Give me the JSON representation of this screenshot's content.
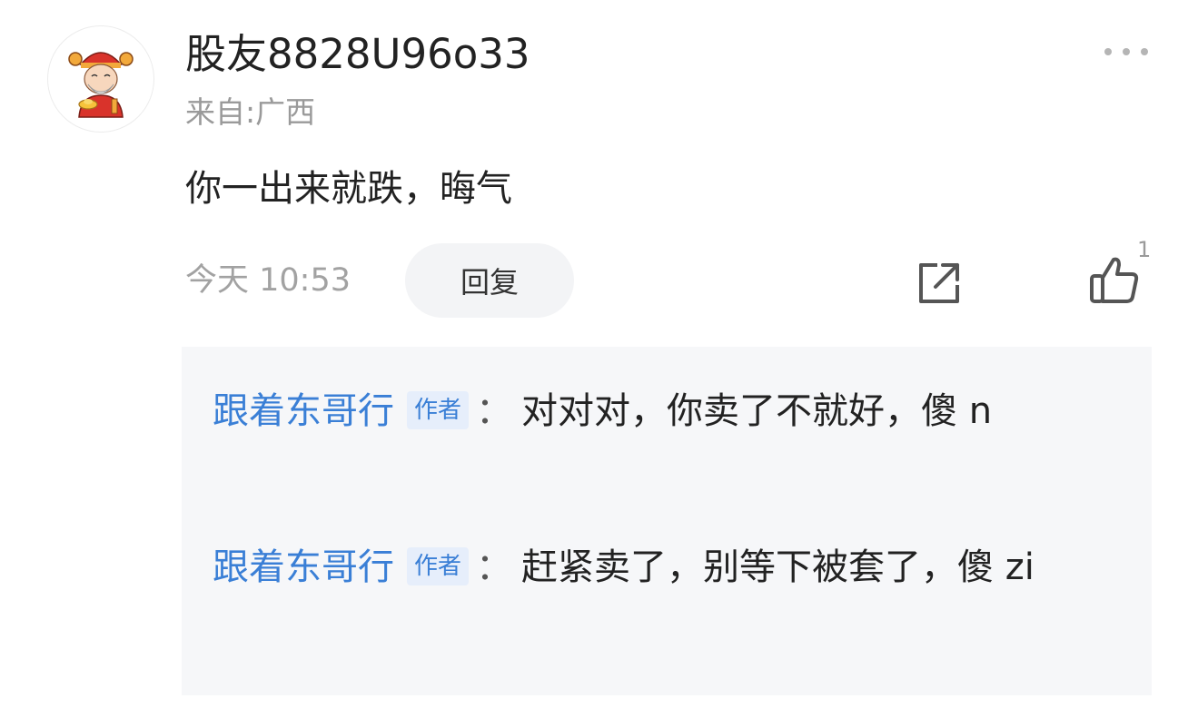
{
  "comment": {
    "username": "股友8828U96o33",
    "location": "来自:广西",
    "text": "你一出来就跌，晦气",
    "timestamp": "今天 10:53",
    "reply_label": "回复",
    "like_count": "1"
  },
  "replies": [
    {
      "author": "跟着东哥行",
      "badge": "作者",
      "separator": "：",
      "text": "对对对，你卖了不就好，傻 n"
    },
    {
      "author": "跟着东哥行",
      "badge": "作者",
      "separator": "：",
      "text": "赶紧卖了，别等下被套了，傻 zi"
    }
  ],
  "icons": {
    "avatar": "caishen-avatar",
    "more": "more-dots-icon",
    "share": "share-icon",
    "like": "thumbs-up-icon"
  },
  "colors": {
    "author_link": "#3a7fd6",
    "badge_bg": "#e6eefb",
    "reply_bg": "#f6f7f9",
    "meta_gray": "#9a9a9a"
  }
}
